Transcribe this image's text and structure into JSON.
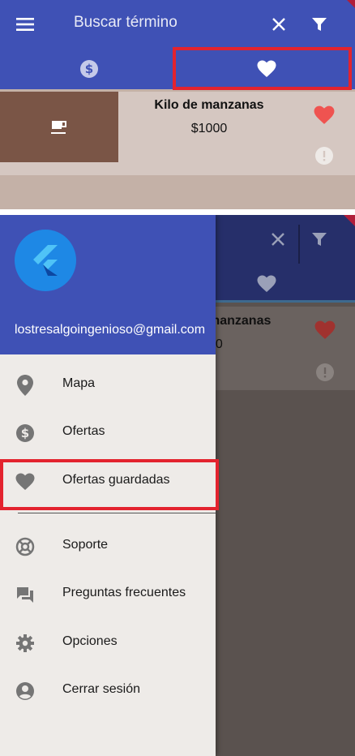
{
  "top": {
    "search_placeholder": "Buscar término",
    "card": {
      "title": "Kilo de manzanas",
      "price": "$1000"
    }
  },
  "bottom": {
    "background_card": {
      "title": "manzanas",
      "price": "00"
    },
    "drawer": {
      "email": "lostresalgoingenioso@gmail.com",
      "items": [
        {
          "label": "Mapa",
          "icon": "location-pin-icon"
        },
        {
          "label": "Ofertas",
          "icon": "dollar-circle-icon"
        },
        {
          "label": "Ofertas guardadas",
          "icon": "heart-icon"
        },
        {
          "label": "Soporte",
          "icon": "lifebuoy-icon"
        },
        {
          "label": "Preguntas frecuentes",
          "icon": "chat-bubbles-icon"
        },
        {
          "label": "Opciones",
          "icon": "gear-icon"
        },
        {
          "label": "Cerrar sesión",
          "icon": "account-circle-icon"
        }
      ]
    }
  },
  "colors": {
    "primary": "#3f51b5",
    "highlight_box": "#e3232e",
    "heart": "#ef5350",
    "tab_indicator": "#64b5f6"
  }
}
